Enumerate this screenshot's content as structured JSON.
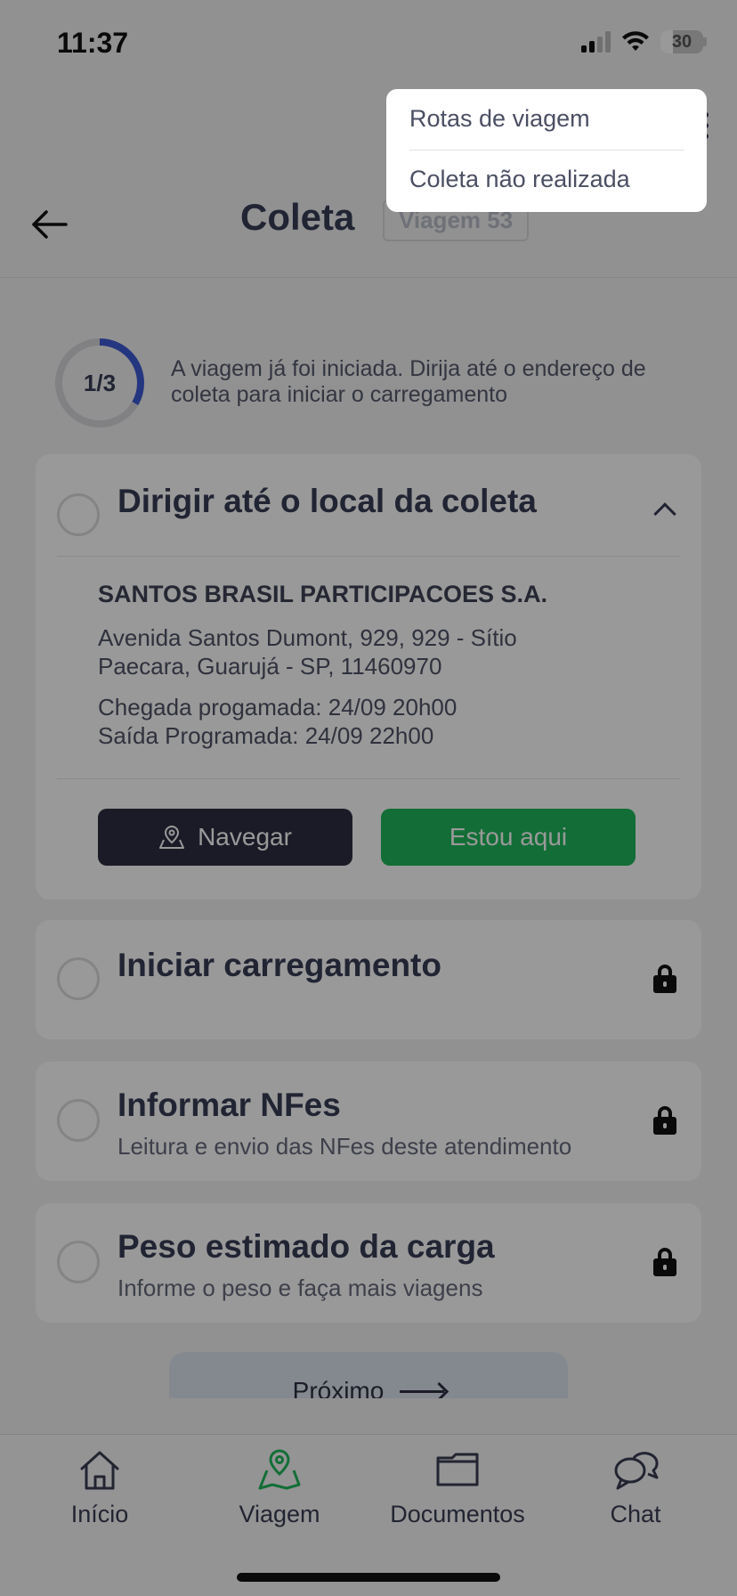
{
  "status_bar": {
    "time": "11:37",
    "battery": "30"
  },
  "header": {
    "title": "Coleta",
    "trip_badge": "Viagem 53"
  },
  "progress": {
    "label": "1/3",
    "fraction": 0.333,
    "message": "A viagem já foi iniciada. Dirija até o endereço de coleta para iniciar o carregamento"
  },
  "steps": [
    {
      "title": "Dirigir até o local da coleta",
      "company": "SANTOS BRASIL PARTICIPACOES S.A.",
      "address_line1": "Avenida Santos Dumont, 929, 929 - Sítio",
      "address_line2": "Paecara, Guarujá - SP, 11460970",
      "arrival": "Chegada progamada: 24/09 20h00",
      "departure": "Saída Programada: 24/09 22h00",
      "navigate_label": "Navegar",
      "here_label": "Estou aqui"
    },
    {
      "title": "Iniciar carregamento",
      "subtitle": ""
    },
    {
      "title": "Informar NFes",
      "subtitle": "Leitura e envio das NFes deste atendimento"
    },
    {
      "title": "Peso estimado da carga",
      "subtitle": "Informe o peso e faça mais viagens"
    }
  ],
  "next_button": {
    "label": "Próximo"
  },
  "tabbar": {
    "items": [
      {
        "label": "Início",
        "icon": "home-icon"
      },
      {
        "label": "Viagem",
        "icon": "map-pin-icon"
      },
      {
        "label": "Documentos",
        "icon": "folder-icon"
      },
      {
        "label": "Chat",
        "icon": "chat-icon"
      }
    ],
    "active": "Viagem"
  },
  "menu": {
    "items": [
      "Rotas de viagem",
      "Coleta não realizada"
    ]
  },
  "colors": {
    "primary_dark": "#2d2d44",
    "success": "#1fb85a",
    "active_tab": "#1fb85a",
    "progress_ring": "#3f5bd6"
  }
}
